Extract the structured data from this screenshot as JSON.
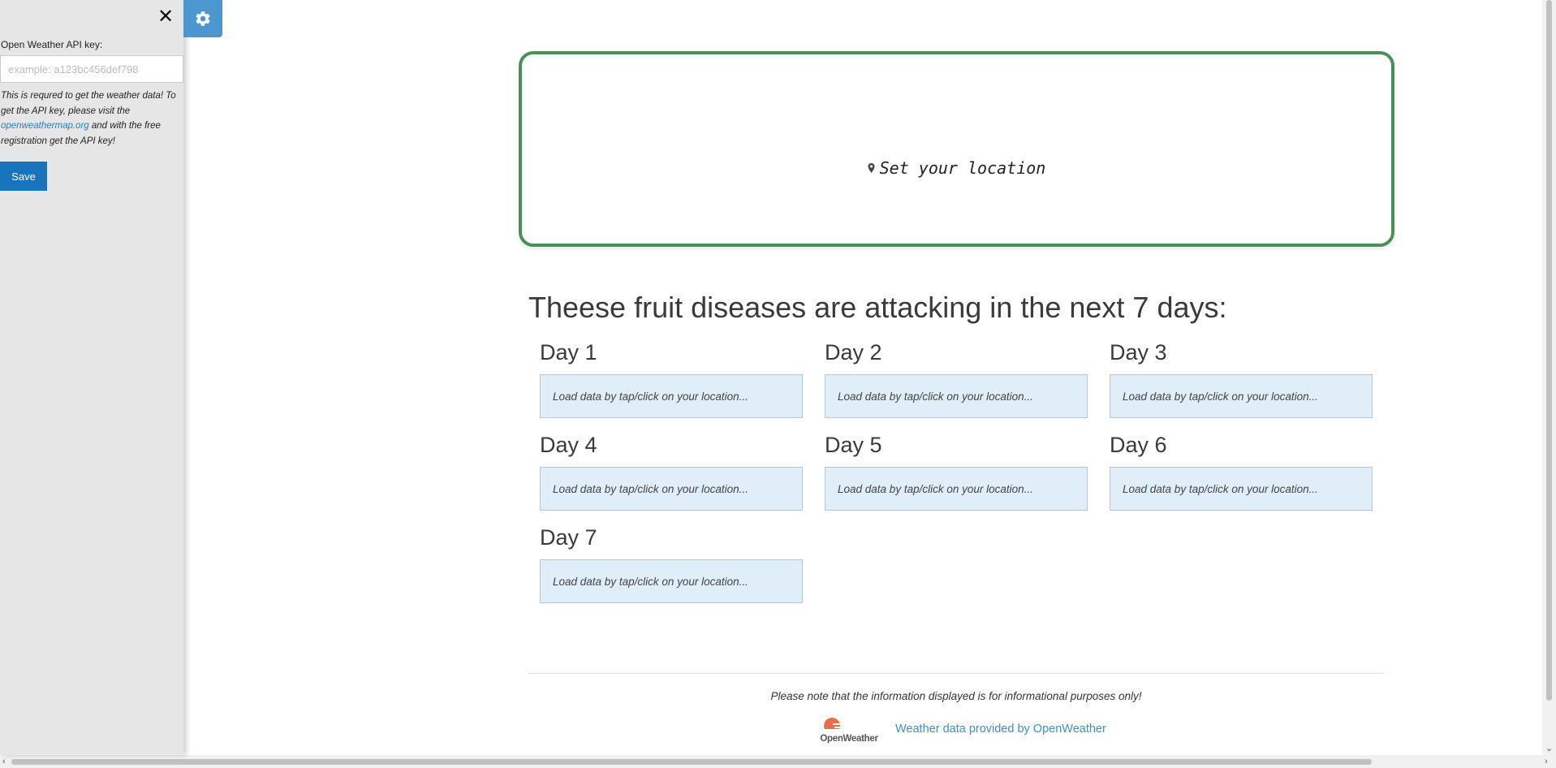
{
  "sidebar": {
    "close_symbol": "✕",
    "api_label": "Open Weather API key:",
    "api_placeholder": "example: a123bc456def798",
    "help_part1": "This is requred to get the weather data! To get the API key, please visit the ",
    "help_link": "openweathermap.org",
    "help_part2": " and with the free registration get the API key!",
    "save_label": "Save"
  },
  "settings": {
    "icon": "gear-icon"
  },
  "location": {
    "icon": "location-pin-icon",
    "label": "Set your location"
  },
  "diseases": {
    "heading": "Theese fruit diseases are attacking in the next 7 days:",
    "days": [
      {
        "label": "Day 1",
        "text": "Load data by tap/click on your location..."
      },
      {
        "label": "Day 2",
        "text": "Load data by tap/click on your location..."
      },
      {
        "label": "Day 3",
        "text": "Load data by tap/click on your location..."
      },
      {
        "label": "Day 4",
        "text": "Load data by tap/click on your location..."
      },
      {
        "label": "Day 5",
        "text": "Load data by tap/click on your location..."
      },
      {
        "label": "Day 6",
        "text": "Load data by tap/click on your location..."
      },
      {
        "label": "Day 7",
        "text": "Load data by tap/click on your location..."
      }
    ]
  },
  "footer": {
    "disclaimer": "Please note that the information displayed is for informational purposes only!",
    "logo_text": "OpenWeather",
    "credit": "Weather data provided by OpenWeather"
  },
  "colors": {
    "card_border": "#4a8f57",
    "day_box_bg": "#dfeef8",
    "save_button": "#1a74bb",
    "gear_button": "#4c97cf",
    "link": "#3b8fcd",
    "logo_orange": "#eb6e4b"
  }
}
